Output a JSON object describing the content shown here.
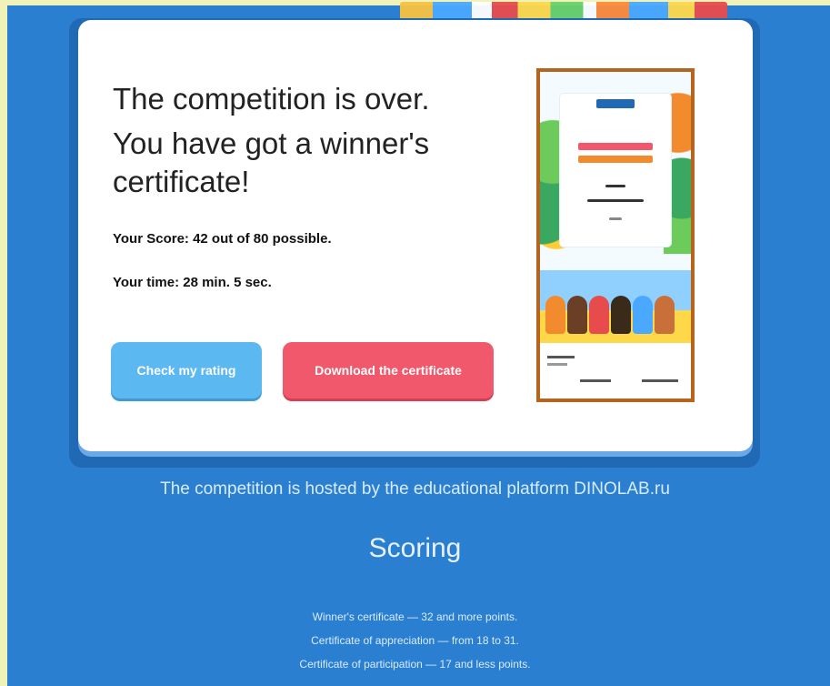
{
  "result": {
    "headline_line1": "The competition is over.",
    "headline_line2": "You have got a winner's certificate!",
    "score_text": "Your Score: 42 out of 80 possible.",
    "time_text": "Your time: 28 min. 5 sec."
  },
  "buttons": {
    "rating_label": "Check my rating",
    "download_label": "Download the certificate"
  },
  "certificate": {
    "frame_color": "#b5651d"
  },
  "footer": {
    "platform_note": "The competition is hosted by the educational platform DINOLAB.ru",
    "scoring_heading": "Scoring",
    "rules": [
      "Winner's certificate — 32 and more points.",
      "Certificate of appreciation — from 18 to 31.",
      "Certificate of participation — 17 and less points."
    ]
  },
  "colors": {
    "page_background": "#2b7fd0",
    "rating_button": "#5bb8f0",
    "download_button": "#f2586c"
  }
}
